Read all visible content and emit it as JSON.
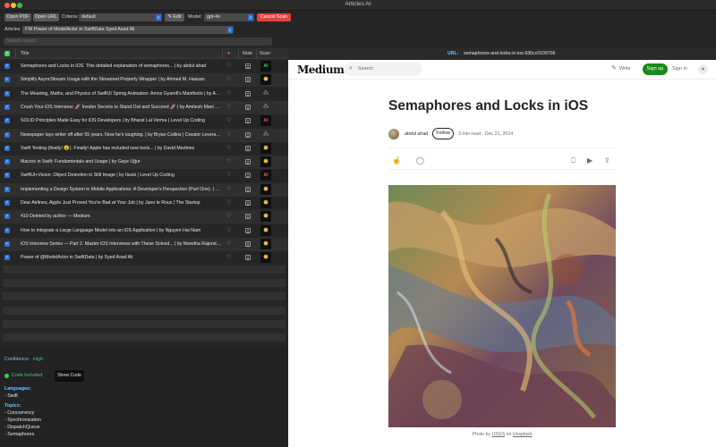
{
  "window": {
    "title": "Articles AI"
  },
  "toolbar": {
    "open_pdf": "Open PDF",
    "open_url": "Open URL",
    "criteria_label": "Criteria:",
    "criteria_value": "default",
    "edit": "Edit",
    "model_label": "Model:",
    "model_value": "gpt-4o",
    "cancel_scan": "Cancel Scan"
  },
  "articles_bar": {
    "label": "Articles",
    "selected": "FW Power of ModelActor in SwiftData  Syed Asad Ali"
  },
  "search": {
    "placeholder": "Search results"
  },
  "table": {
    "headers": {
      "title": "Title",
      "heart": "♥",
      "note": "Note",
      "scan": "Scan"
    },
    "rows": [
      {
        "title": "Semaphores and Locks in iOS. This detailed explanation of semaphores... | by abdul ahad",
        "scan": "AI",
        "scan_kind": "ai-green"
      },
      {
        "title": "Simplify AsyncStream Usage with the Streamed Property Wrapper | by Ahmed M. Hassan",
        "scan": "✸",
        "scan_kind": "spark"
      },
      {
        "title": "The Meaning, Maths, and Physics of SwiftUI Spring Animation: Amos Gyamfi's Manifesto | by Amo...",
        "scan": "⁂",
        "scan_kind": "spin"
      },
      {
        "title": "Crush Your iOS Interview: 🚀 Insider Secrets to Stand Out and Succeed 🚀 | by Amitesh Mani Ti...",
        "scan": "⁂",
        "scan_kind": "spin"
      },
      {
        "title": "SOLID Principles Made Easy for iOS Developers | by Bharat Lal Verma | Level Up Coding",
        "scan": "AI",
        "scan_kind": "ai"
      },
      {
        "title": "Newspaper lays writer off after 55 years. Now he's laughing. | by Bryan Collins | Creator Leverage",
        "scan": "⁂",
        "scan_kind": "spin"
      },
      {
        "title": "Swift Testing (finally! 😮). Finally! Apple has included new tools... | by David Martinez",
        "scan": "✸",
        "scan_kind": "spark"
      },
      {
        "title": "Macros in Swift: Fundamentals and Usage | by Gaye Uğur",
        "scan": "✸",
        "scan_kind": "spark"
      },
      {
        "title": "SwiftUI+Vision: Object Detection in Still Image | by Itsuki | Level Up Coding",
        "scan": "AI",
        "scan_kind": "ai"
      },
      {
        "title": "Implementing a Design System in Mobile Applications: A Developer's Perspective (Part One). | by...",
        "scan": "✸",
        "scan_kind": "spark"
      },
      {
        "title": "Dear Airlines, Apple Just Proved You're Bad at Your Job | by Jano le Roux | The Startup",
        "scan": "✸",
        "scan_kind": "spark"
      },
      {
        "title": "410 Deleted by author — Medium",
        "scan": "✸",
        "scan_kind": "spark"
      },
      {
        "title": "How to integrate a Large Language Model into an iOS Application | by Nguyen Hai Nam",
        "scan": "✸",
        "scan_kind": "spark"
      },
      {
        "title": "iOS Interview Series — Part 2. Master iOS Interviews with These Solved... | by Nivedha Rajendran",
        "scan": "✸",
        "scan_kind": "spark"
      },
      {
        "title": "Power of @ModelActor in SwiftData | by Syed Asad Ali",
        "scan": "✸",
        "scan_kind": "spark"
      }
    ]
  },
  "detail": {
    "confidence_label": "Confidence:",
    "confidence_value": "High",
    "code_included": "Code Included",
    "show_code": "Show Code",
    "languages_label": "Languages:",
    "languages": [
      "- Swift"
    ],
    "topics_label": "Topics:",
    "topics": [
      "- Concurrency",
      "- Synchronization",
      "- DispatchQueue",
      "- Semaphores"
    ]
  },
  "web": {
    "url_label": "URL:",
    "url_value": "semaphores-and-locks-in-ios-936cc0109706",
    "medium_logo": "Medium",
    "search_placeholder": "Search",
    "write": "Write",
    "sign_up": "Sign up",
    "sign_in": "Sign in",
    "article_title": "Semaphores and Locks in iOS",
    "author": "abdul ahad",
    "follow": "Follow",
    "read_time": "3 min read",
    "date": "Dec 21, 2024",
    "caption_prefix": "Photo by",
    "caption_source": "USGS",
    "caption_on": "on",
    "caption_site": "Unsplash"
  }
}
